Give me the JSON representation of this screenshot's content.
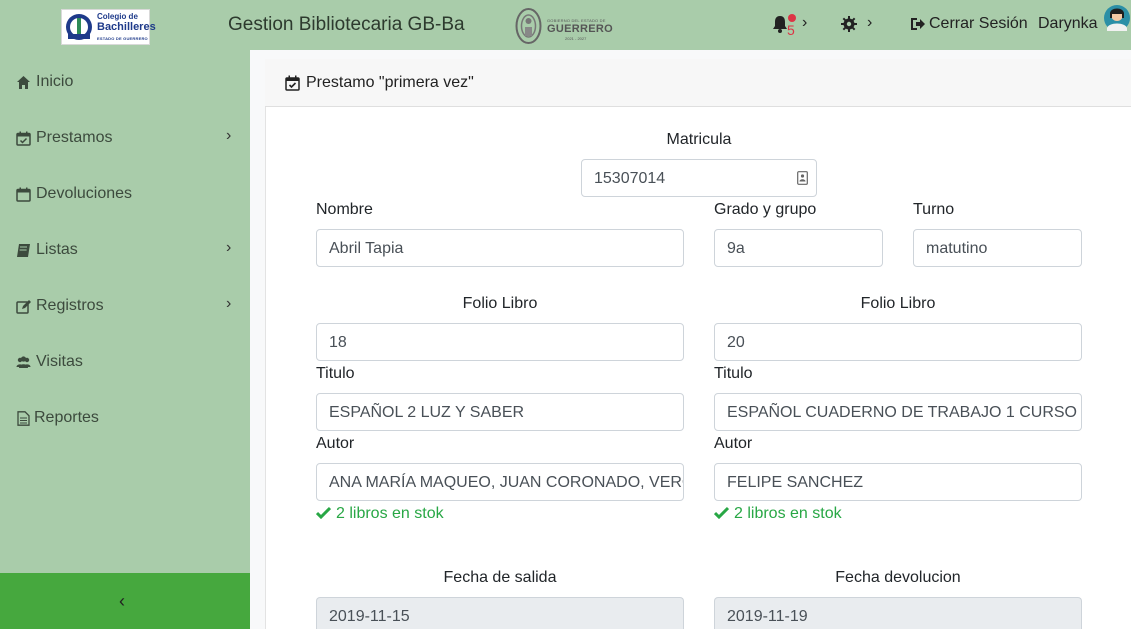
{
  "header": {
    "logo": {
      "line1": "Colegio de",
      "line2": "Bachilleres",
      "line3": "ESTADO DE GUERRERO"
    },
    "app_title": "Gestion Bibliotecaria GB-Ba",
    "gov_logo": {
      "small_text": "GOBIERNO DEL ESTADO DE",
      "name": "GUERRERO",
      "years": "2021 - 2027"
    },
    "notifications_count": "5",
    "logout_label": "Cerrar Sesión",
    "user_name": "Darynka"
  },
  "sidebar": {
    "items": [
      {
        "label": "Inicio",
        "icon": "home-icon",
        "has_submenu": false
      },
      {
        "label": "Prestamos",
        "icon": "calendar-check-icon",
        "has_submenu": true
      },
      {
        "label": "Devoluciones",
        "icon": "calendar-icon",
        "has_submenu": false
      },
      {
        "label": "Listas",
        "icon": "book-icon",
        "has_submenu": true
      },
      {
        "label": "Registros",
        "icon": "edit-icon",
        "has_submenu": true
      },
      {
        "label": "Visitas",
        "icon": "users-icon",
        "has_submenu": false
      },
      {
        "label": "Reportes",
        "icon": "file-text-icon",
        "has_submenu": false
      }
    ],
    "collapse_icon": "chevron-left-icon"
  },
  "card": {
    "title": "Prestamo \"primera vez\""
  },
  "form": {
    "matricula_label": "Matricula",
    "matricula_value": "15307014",
    "nombre_label": "Nombre",
    "nombre_value": "Abril Tapia",
    "grado_label": "Grado y grupo",
    "grado_value": "9a",
    "turno_label": "Turno",
    "turno_value": "matutino",
    "books": [
      {
        "folio_label": "Folio Libro",
        "folio_value": "18",
        "titulo_label": "Titulo",
        "titulo_value": "ESPAÑOL 2 LUZ Y SABER",
        "autor_label": "Autor",
        "autor_value": "ANA MARÍA MAQUEO, JUAN CORONADO, VERÓNICA",
        "stock_text": "2 libros en stok"
      },
      {
        "folio_label": "Folio Libro",
        "folio_value": "20",
        "titulo_label": "Titulo",
        "titulo_value": "ESPAÑOL CUADERNO DE TRABAJO 1 CURSO",
        "autor_label": "Autor",
        "autor_value": "FELIPE SANCHEZ",
        "stock_text": "2 libros en stok"
      }
    ],
    "fecha_salida_label": "Fecha de salida",
    "fecha_salida_value": "2019-11-15",
    "fecha_devolucion_label": "Fecha devolucion",
    "fecha_devolucion_value": "2019-11-19"
  },
  "colors": {
    "header_bg": "#a9ccaa",
    "sidebar_bg": "#a9ccaa",
    "collapse_bg": "#46a83e",
    "stock_green": "#28a745",
    "notif_red": "#dc3545"
  }
}
